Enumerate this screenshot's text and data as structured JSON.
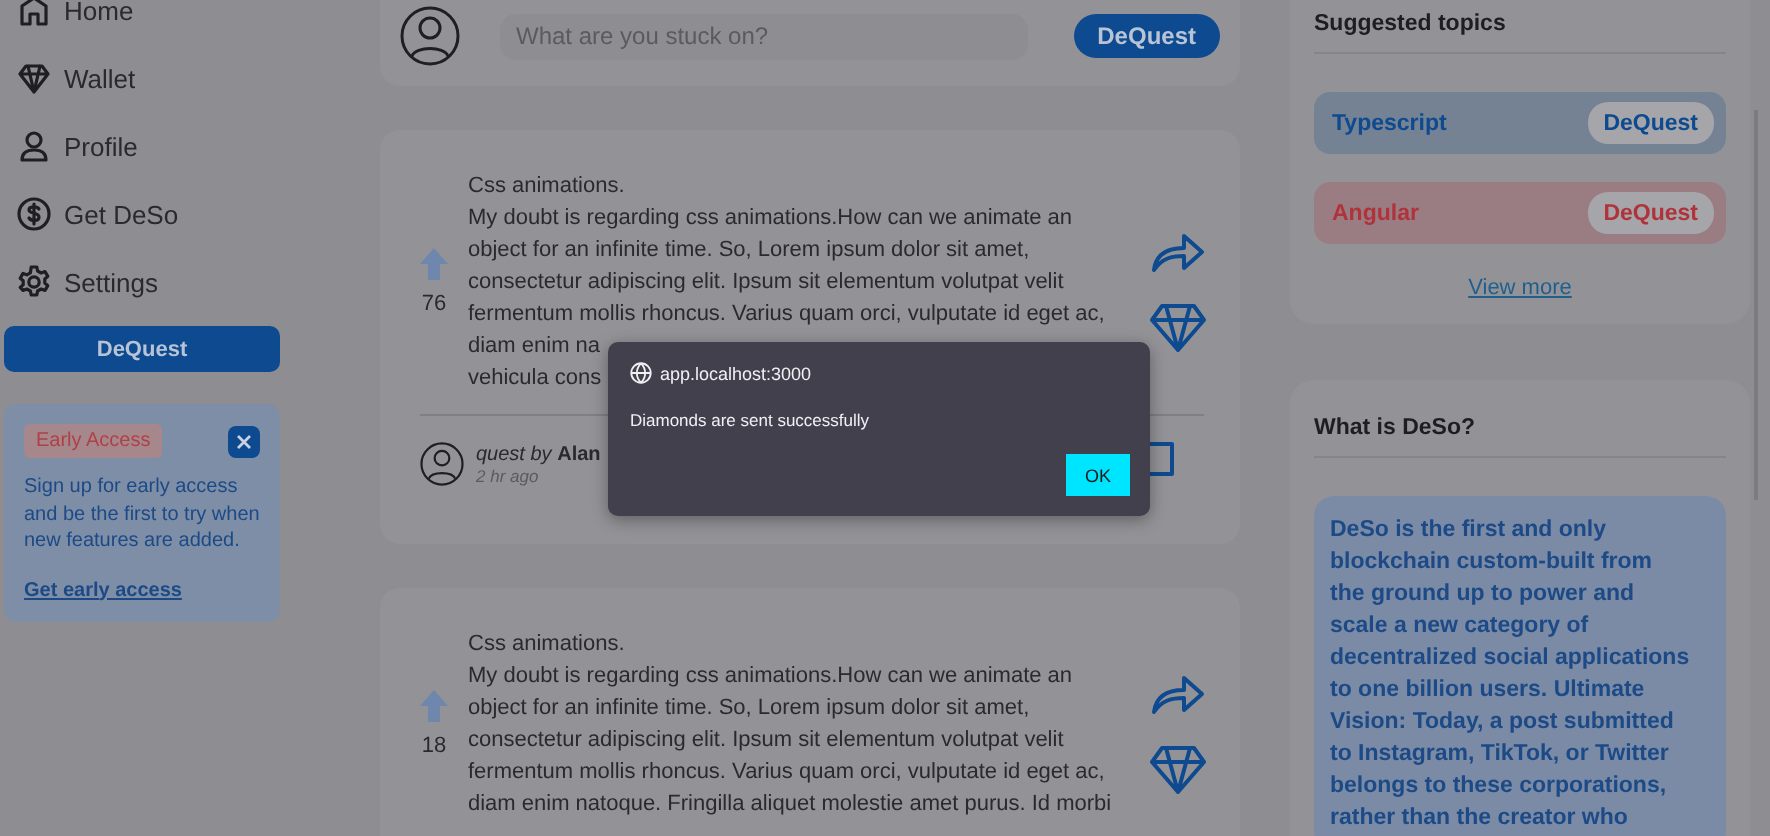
{
  "sidebar": {
    "items": [
      {
        "label": "Home"
      },
      {
        "label": "Wallet"
      },
      {
        "label": "Profile"
      },
      {
        "label": "Get DeSo"
      },
      {
        "label": "Settings"
      }
    ],
    "button": "DeQuest",
    "early_access": {
      "badge": "Early Access",
      "text": "Sign up for early access and be the first to try when new features are added.",
      "link": "Get early access"
    }
  },
  "composer": {
    "placeholder": "What are you stuck on?",
    "button": "DeQuest"
  },
  "posts": [
    {
      "votes": "76",
      "lines": [
        "Css animations.",
        "My doubt is regarding css animations.How can we animate an",
        "object for an infinite time. So, Lorem ipsum dolor sit amet,",
        "consectetur adipiscing elit. Ipsum sit elementum volutpat velit",
        "fermentum mollis rhoncus. Varius quam orci, vulputate id eget ac,",
        "diam enim na",
        "vehicula cons"
      ],
      "author": "*quest by* **Alan**",
      "time": "2 hr ago"
    },
    {
      "votes": "18",
      "lines": [
        "Css animations.",
        "My doubt is regarding css animations.How can we animate an",
        "object for an infinite time. So, Lorem ipsum dolor sit amet,",
        "consectetur adipiscing elit. Ipsum sit elementum volutpat velit",
        "fermentum mollis rhoncus. Varius quam orci, vulputate id eget ac,",
        "diam enim natoque. Fringilla aliquet molestie amet purus. Id morbi"
      ]
    }
  ],
  "suggested_topics": {
    "title": "Suggested topics",
    "topics": [
      {
        "label": "Typescript",
        "button": "DeQuest",
        "color": "#0d4a8f"
      },
      {
        "label": "Angular",
        "button": "DeQuest",
        "color": "#b0323a"
      }
    ],
    "view_more": "View more"
  },
  "about": {
    "title": "What is DeSo?",
    "lines": [
      "DeSo is the first and only",
      "blockchain custom-built from",
      "the ground up to power and",
      "scale a new category of",
      "decentralized social applications",
      "to one billion users. Ultimate",
      "Vision: Today, a post submitted",
      "to Instagram, TikTok, or Twitter",
      "belongs to these corporations,",
      "rather than the creator who"
    ]
  },
  "dialog": {
    "origin": "app.localhost:3000",
    "message": "Diamonds are sent successfully",
    "button": "OK"
  }
}
